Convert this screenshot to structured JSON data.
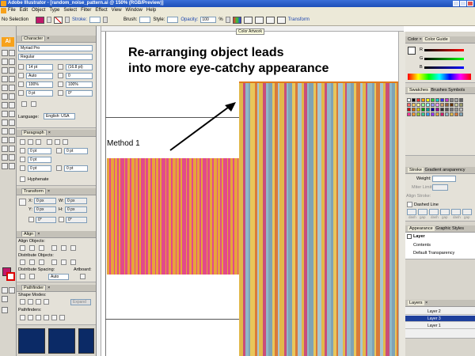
{
  "window": {
    "title": "Adobe Illustrator - [random_noise_pattern.ai @ 150% (RGB/Preview)]"
  },
  "menu": [
    "File",
    "Edit",
    "Object",
    "Type",
    "Select",
    "Filter",
    "Effect",
    "View",
    "Window",
    "Help"
  ],
  "control_bar": {
    "selection": "No Selection",
    "stroke_label": "Stroke:",
    "brush_label": "Brush:",
    "style_label": "Style:",
    "opacity_label": "Opacity:",
    "opacity_value": "100",
    "opacity_unit": "%",
    "transform_link": "Transform"
  },
  "character_panel": {
    "title": "Character",
    "font_family": "Myriad Pro",
    "font_style": "Regular",
    "size": "14 pt",
    "leading": "(16.8 pt)",
    "kerning": "Auto",
    "tracking": "0",
    "scale_v": "100%",
    "scale_h": "100%",
    "baseline": "0 pt",
    "rotation": "0°",
    "language_label": "Language:",
    "language": "English: USA"
  },
  "paragraph_panel": {
    "title": "Paragraph",
    "indent_left": "0 pt",
    "indent_right": "0 pt",
    "first_line": "0 pt",
    "space_before": "0 pt",
    "space_after": "0 pt",
    "hyphenate": "Hyphenate"
  },
  "transform_panel": {
    "title": "Transform",
    "x": "0 px",
    "y": "0 px",
    "w": "0 px",
    "h": "0 px",
    "angle": "0°",
    "shear": "0°",
    "x_label": "X:",
    "y_label": "Y:",
    "w_label": "W:",
    "h_label": "H:"
  },
  "align_panel": {
    "title": "Align",
    "align_objects": "Align Objects:",
    "distribute_objects": "Distribute Objects:",
    "distribute_spacing": "Distribute Spacing:",
    "spacing_value": "Auto",
    "artboard": "Artboard:"
  },
  "pathfinder_panel": {
    "title": "Pathfinder",
    "shape_modes": "Shape Modes:",
    "pathfinders": "Pathfinders:",
    "expand": "Expand"
  },
  "tooltip": "Color Artwork",
  "canvas": {
    "heading_line1": "Re-arranging object leads",
    "heading_line2": "into more eye-catchy appearance",
    "method_label": "Method 1"
  },
  "color_panel": {
    "tab1": "Color",
    "tab2": "Color Guide",
    "r": "R",
    "g": "G",
    "b": "B"
  },
  "swatches_panel": {
    "tab1": "Swatches",
    "tab2": "Brushes",
    "tab3": "Symbols"
  },
  "stroke_panel": {
    "tab1": "Stroke",
    "tab2": "Gradient",
    "tab3": "ansparency",
    "weight": "Weight:",
    "miter": "Miter Limit:",
    "align_stroke": "Align Stroke:",
    "dashed": "Dashed Line",
    "dash_labels": [
      "dash",
      "gap",
      "dash",
      "gap",
      "dash",
      "gap"
    ]
  },
  "appearance_panel": {
    "tab1": "Appearance",
    "tab2": "Graphic Styles",
    "layer": "Layer",
    "contents": "Contents",
    "transparency": "Default Transparency"
  },
  "layers_panel": {
    "title": "Layers",
    "layers": [
      "Layer 2",
      "Layer 3",
      "Layer 1"
    ]
  },
  "colors": {
    "stripes1": [
      "#d81b6b",
      "#e8a33b",
      "#c0185f",
      "#a8126a",
      "#e24a8a",
      "#d51c5c"
    ],
    "stripes2": [
      "#8fb8c8",
      "#e2b84a",
      "#d97a3a",
      "#7fa3b5",
      "#c94e7a",
      "#a8c6d0",
      "#e8c65a"
    ]
  }
}
